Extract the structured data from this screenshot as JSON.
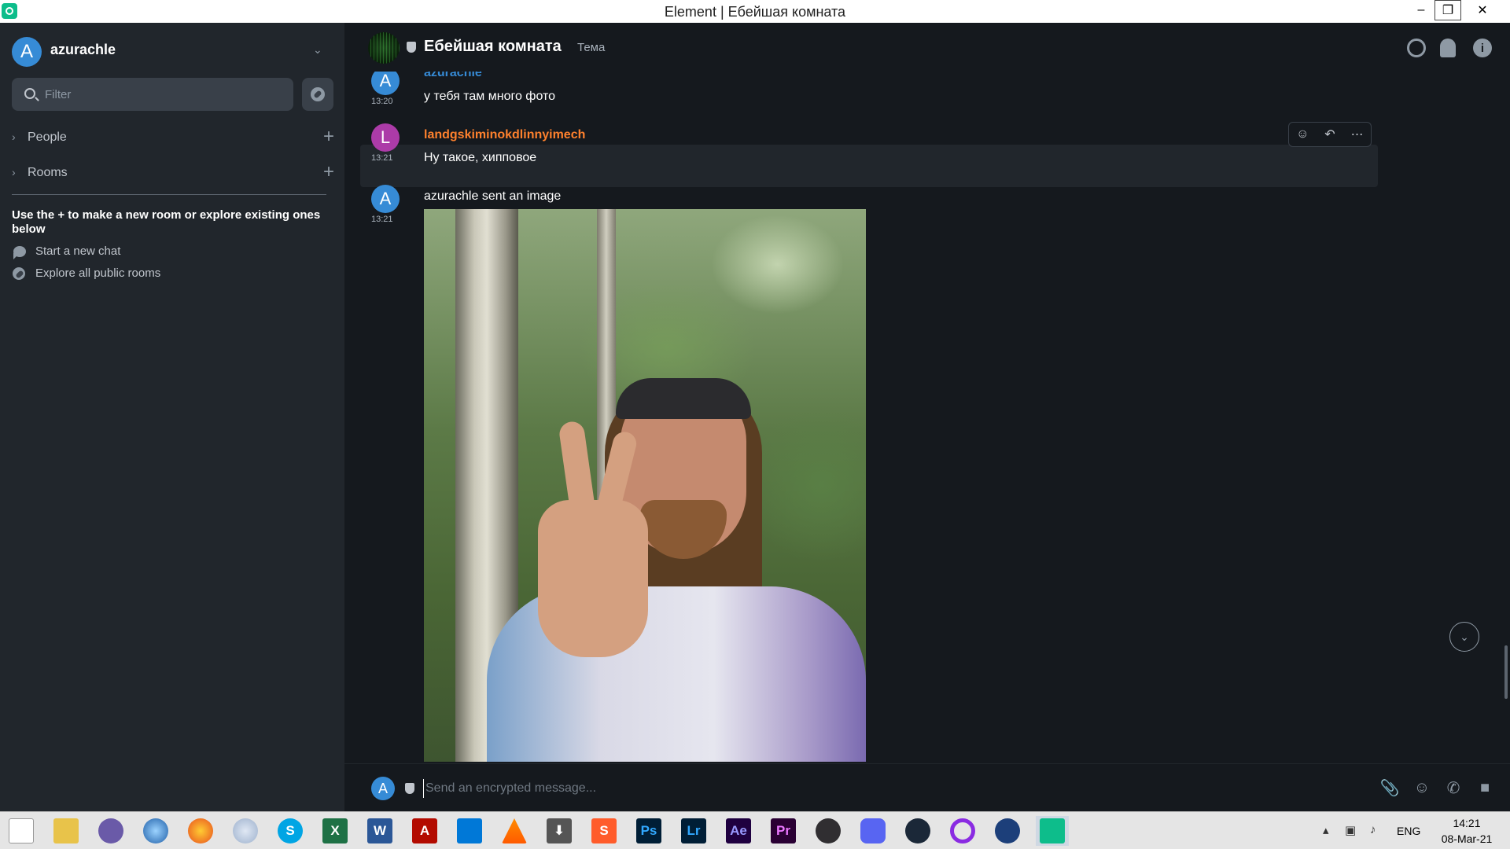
{
  "window": {
    "title": "Element | Ебейшая комната",
    "minimize": "–",
    "restore": "❐",
    "close": "✕"
  },
  "sidebar": {
    "user_initial": "A",
    "user_name": "azurachle",
    "user_menu_chevron": "⌄",
    "filter_placeholder": "Filter",
    "sections": [
      {
        "label": "People",
        "chevron": "›",
        "add": "+"
      },
      {
        "label": "Rooms",
        "chevron": "›",
        "add": "+"
      }
    ],
    "hint": "Use the + to make a new room or explore existing ones below",
    "actions": [
      {
        "label": "Start a new chat",
        "icon": "chat-bubble-icon"
      },
      {
        "label": "Explore all public rooms",
        "icon": "compass-icon"
      }
    ]
  },
  "room": {
    "name": "Ебейшая комната",
    "topic": "Тема",
    "header_icons": [
      "search-icon",
      "bell-icon",
      "info-icon"
    ],
    "info_glyph": "i"
  },
  "messages": [
    {
      "sender": "azurachle",
      "initial": "A",
      "time": "13:20",
      "text": "у тебя там много фото",
      "sender_color": "#368bd6",
      "avatar_color": "#368bd6"
    },
    {
      "sender": "landgskiminokdlinnyimech",
      "initial": "L",
      "time": "13:21",
      "text": "Ну такое, хипповое",
      "sender_color": "#ff812d",
      "avatar_color": "#ac3ba8"
    },
    {
      "sender": "",
      "initial": "A",
      "time": "13:21",
      "text": "azurachle sent an image",
      "avatar_color": "#368bd6"
    }
  ],
  "message_actions": [
    {
      "name": "react-icon",
      "glyph": "☺"
    },
    {
      "name": "reply-icon",
      "glyph": "↶"
    },
    {
      "name": "options-icon",
      "glyph": "⋯"
    }
  ],
  "jump_to_bottom_glyph": "⌄",
  "composer": {
    "initial": "A",
    "placeholder": "Send an encrypted message...",
    "icons": [
      "paperclip-icon",
      "emoji-icon",
      "voice-call-icon",
      "video-call-icon"
    ]
  },
  "taskbar": {
    "apps": [
      {
        "name": "windows-start-icon",
        "text": ""
      },
      {
        "name": "file-explorer-icon",
        "text": ""
      },
      {
        "name": "bittorrent-icon",
        "text": ""
      },
      {
        "name": "browser-globe-icon",
        "text": ""
      },
      {
        "name": "firefox-icon",
        "text": ""
      },
      {
        "name": "moon-app-icon",
        "text": ""
      },
      {
        "name": "skype-icon",
        "text": "S"
      },
      {
        "name": "excel-icon",
        "text": "X"
      },
      {
        "name": "word-icon",
        "text": "W"
      },
      {
        "name": "acrobat-icon",
        "text": "A"
      },
      {
        "name": "vscode-icon",
        "text": ""
      },
      {
        "name": "vlc-icon",
        "text": ""
      },
      {
        "name": "download-icon",
        "text": "⬇"
      },
      {
        "name": "sublime-icon",
        "text": "S"
      },
      {
        "name": "photoshop-icon",
        "text": "Ps"
      },
      {
        "name": "lightroom-icon",
        "text": "Lr"
      },
      {
        "name": "after-effects-icon",
        "text": "Ae"
      },
      {
        "name": "premiere-icon",
        "text": "Pr"
      },
      {
        "name": "obs-icon",
        "text": ""
      },
      {
        "name": "discord-icon",
        "text": ""
      },
      {
        "name": "steam-icon",
        "text": ""
      },
      {
        "name": "cortana-ring-icon",
        "text": ""
      },
      {
        "name": "vpn-lock-icon",
        "text": ""
      },
      {
        "name": "element-icon",
        "text": ""
      }
    ],
    "tray_arrow": "▴",
    "language": "ENG",
    "time": "14:21",
    "date": "08-Mar-21"
  },
  "colors": {
    "accent_green": "#0dbd8b",
    "sidebar_bg": "#21262c",
    "timeline_bg": "#15191e"
  }
}
